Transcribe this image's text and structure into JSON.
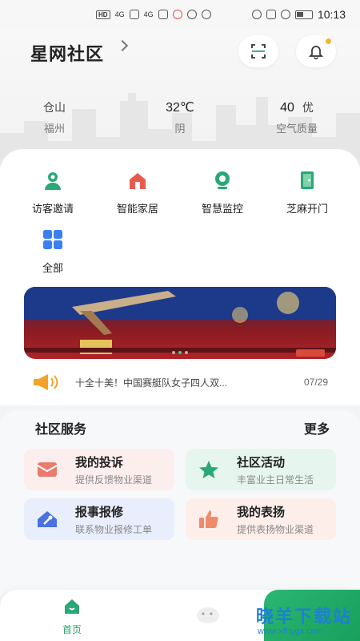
{
  "status_bar": {
    "time": "10:13",
    "network_badge": "HD",
    "signal1": "4G",
    "signal2": "4G"
  },
  "header": {
    "title": "星网社区",
    "icons": [
      "scan-icon",
      "bell-icon"
    ]
  },
  "weather": {
    "district": "仓山",
    "city": "福州",
    "temperature": "32℃",
    "condition": "阴",
    "aqi_value": "40",
    "aqi_level": "优",
    "aqi_label": "空气质量"
  },
  "quick_actions": [
    {
      "label": "访客邀请",
      "icon": "visitor-icon",
      "color": "#2aa876"
    },
    {
      "label": "智能家居",
      "icon": "home-icon",
      "color": "#e85a4f"
    },
    {
      "label": "智慧监控",
      "icon": "camera-icon",
      "color": "#2aa876"
    },
    {
      "label": "芝麻开门",
      "icon": "door-icon",
      "color": "#2aa876"
    },
    {
      "label": "全部",
      "icon": "grid-icon",
      "color": "#3b7ff0"
    }
  ],
  "notice": {
    "text": "十全十美！中国赛艇队女子四人双...",
    "date": "07/29"
  },
  "services": {
    "title": "社区服务",
    "more": "更多",
    "items": [
      {
        "title": "我的投诉",
        "subtitle": "提供反馈物业渠道",
        "icon": "complaint-icon",
        "bg": "#fdeeee",
        "accent": "#e97a6e"
      },
      {
        "title": "社区活动",
        "subtitle": "丰富业主日常生活",
        "icon": "star-icon",
        "bg": "#e6f6ee",
        "accent": "#2aa876"
      },
      {
        "title": "报事报修",
        "subtitle": "联系物业报修工单",
        "icon": "repair-icon",
        "bg": "#e8eefc",
        "accent": "#4a72e0"
      },
      {
        "title": "我的表扬",
        "subtitle": "提供表扬物业渠道",
        "icon": "thumbs-up-icon",
        "bg": "#fdeeea",
        "accent": "#ef8a6a"
      }
    ]
  },
  "bottom_nav": {
    "home_label": "首页"
  },
  "watermark": {
    "text": "晓羊下载站",
    "url": "www.xfhygs.com"
  }
}
